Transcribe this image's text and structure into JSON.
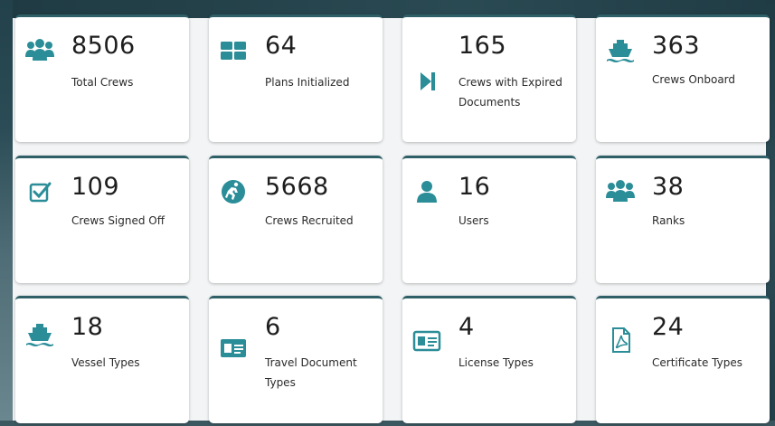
{
  "colors": {
    "accent": "#2a8d98",
    "card_border": "#2f6068",
    "background_dark": "#22414a"
  },
  "cards": [
    {
      "count": "8506",
      "label": "Total Crews",
      "icon": "users-group-icon"
    },
    {
      "count": "64",
      "label": "Plans Initialized",
      "icon": "grid-icon"
    },
    {
      "count": "165",
      "label": "Crews with Expired Documents",
      "icon": "skip-forward-icon"
    },
    {
      "count": "363",
      "label": "Crews Onboard",
      "icon": "ship-icon"
    },
    {
      "count": "109",
      "label": "Crews Signed Off",
      "icon": "checkbox-icon"
    },
    {
      "count": "5668",
      "label": "Crews Recruited",
      "icon": "recruit-icon"
    },
    {
      "count": "16",
      "label": "Users",
      "icon": "user-icon"
    },
    {
      "count": "38",
      "label": "Ranks",
      "icon": "users-group-icon"
    },
    {
      "count": "18",
      "label": "Vessel Types",
      "icon": "ship-icon"
    },
    {
      "count": "6",
      "label": "Travel Document Types",
      "icon": "id-card-icon"
    },
    {
      "count": "4",
      "label": "License Types",
      "icon": "license-card-icon"
    },
    {
      "count": "24",
      "label": "Certificate Types",
      "icon": "pdf-file-icon"
    }
  ]
}
